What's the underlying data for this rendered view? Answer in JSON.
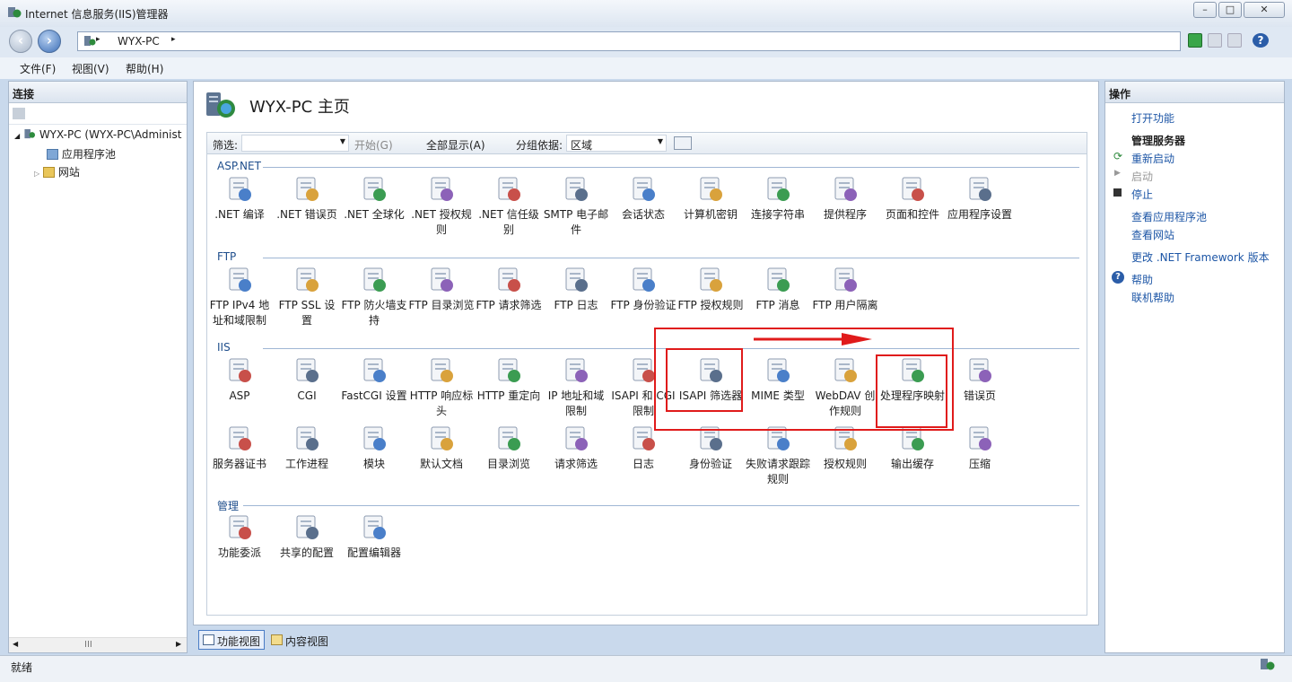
{
  "window": {
    "title": "Internet 信息服务(IIS)管理器",
    "controls": [
      "–",
      "□",
      "✕"
    ]
  },
  "address": {
    "path": "WYX-PC",
    "sep": "▸"
  },
  "menu": [
    "文件(F)",
    "视图(V)",
    "帮助(H)"
  ],
  "left": {
    "header": "连接",
    "tree": {
      "root": "WYX-PC (WYX-PC\\Administ",
      "children": [
        "应用程序池",
        "网站"
      ]
    },
    "scroll_label": "III"
  },
  "center": {
    "title": "WYX-PC 主页",
    "filter": {
      "label": "筛选:",
      "start": "开始(G)",
      "showall": "全部显示(A)",
      "groupby": "分组依据:",
      "group_value": "区域"
    },
    "groups": [
      {
        "name": "ASP.NET",
        "items": [
          ".NET 编译",
          ".NET 错误页",
          ".NET 全球化",
          ".NET 授权规则",
          ".NET 信任级别",
          "SMTP 电子邮件",
          "会话状态",
          "计算机密钥",
          "连接字符串",
          "提供程序",
          "页面和控件",
          "应用程序设置"
        ]
      },
      {
        "name": "FTP",
        "items": [
          "FTP IPv4 地址和域限制",
          "FTP SSL 设置",
          "FTP 防火墙支持",
          "FTP 目录浏览",
          "FTP 请求筛选",
          "FTP 日志",
          "FTP 身份验证",
          "FTP 授权规则",
          "FTP 消息",
          "FTP 用户隔离"
        ]
      },
      {
        "name": "IIS",
        "items": [
          "ASP",
          "CGI",
          "FastCGI 设置",
          "HTTP 响应标头",
          "HTTP 重定向",
          "IP 地址和域限制",
          "ISAPI 和 CGI 限制",
          "ISAPI 筛选器",
          "MIME 类型",
          "WebDAV 创作规则",
          "处理程序映射",
          "错误页",
          "服务器证书",
          "工作进程",
          "模块",
          "默认文档",
          "目录浏览",
          "请求筛选",
          "日志",
          "身份验证",
          "失败请求跟踪规则",
          "授权规则",
          "输出缓存",
          "压缩"
        ]
      },
      {
        "name": "管理",
        "items": [
          "功能委派",
          "共享的配置",
          "配置编辑器"
        ]
      }
    ]
  },
  "bottom": {
    "feature_view": "功能视图",
    "content_view": "内容视图"
  },
  "right": {
    "header": "操作",
    "open_feature": "打开功能",
    "manage_server": "管理服务器",
    "restart": "重新启动",
    "start": "启动",
    "stop": "停止",
    "view_pools": "查看应用程序池",
    "view_sites": "查看网站",
    "change_net": "更改 .NET Framework 版本",
    "help": "帮助",
    "online_help": "联机帮助"
  },
  "status": "就绪",
  "colors": {
    "accent": "#1d56a6",
    "highlight": "#e01b1b"
  }
}
